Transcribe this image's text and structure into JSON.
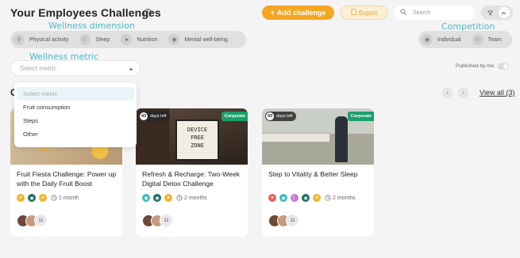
{
  "header": {
    "title": "Your Employees Challenges",
    "add_label": "Add challenge",
    "export_label": "Export",
    "search_placeholder": "Search"
  },
  "annotations": {
    "wellness_dimension": "Wellness dimension",
    "competition": "Competition",
    "wellness_metric": "Wellness metric"
  },
  "dimensions": [
    {
      "label": "Physical activity",
      "icon": "running-icon"
    },
    {
      "label": "Sleep",
      "icon": "moon-icon"
    },
    {
      "label": "Nutrition",
      "icon": "apple-icon"
    },
    {
      "label": "Mental well-being",
      "icon": "eye-icon"
    }
  ],
  "competition": [
    {
      "label": "Individual",
      "icon": "person-icon"
    },
    {
      "label": "Team",
      "icon": "team-icon"
    }
  ],
  "metric_select": {
    "placeholder": "Select metric",
    "options": [
      "Select metric",
      "Fruit consumption",
      "Steps",
      "Other"
    ]
  },
  "published_by_me": "Published by me",
  "section_initial": "C",
  "view_all": "View all (3)",
  "cards": [
    {
      "title": "Fruit Fiesta Challenge: Power up with the Daily Fruit Boost",
      "duration": "1 month",
      "count": "11",
      "days_left_num": "",
      "days_left_text": "",
      "corporate": "",
      "tag_colors": [
        "#f5b42f",
        "#1e6e64",
        "#f5b42f"
      ]
    },
    {
      "title": "Refresh & Recharge: Two-Week Digital Detox Challenge",
      "duration": "2 months",
      "count": "11",
      "days_left_num": "43",
      "days_left_text": "days left",
      "corporate": "Corporate",
      "tag_colors": [
        "#3fb8c0",
        "#1e6e64",
        "#f5b42f"
      ]
    },
    {
      "title": "Step to Vitality & Better Sleep",
      "duration": "2 months",
      "count": "11",
      "days_left_num": "43",
      "days_left_text": "days left",
      "corporate": "Corporate",
      "tag_colors": [
        "#e8635a",
        "#3fb8c0",
        "#c77ad8",
        "#1e6e64",
        "#f5b42f"
      ]
    }
  ]
}
